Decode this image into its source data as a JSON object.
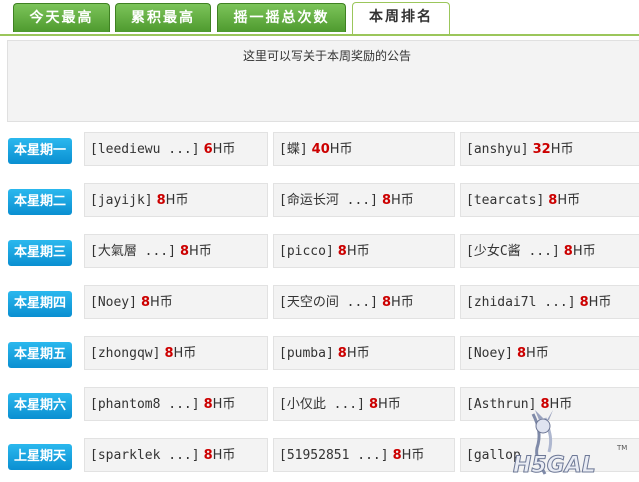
{
  "tabs": [
    {
      "label": "今天最高",
      "active": false
    },
    {
      "label": "累积最高",
      "active": false
    },
    {
      "label": "摇一摇总次数",
      "active": false
    },
    {
      "label": "本周排名",
      "active": true
    }
  ],
  "notice": "这里可以写关于本周奖励的公告",
  "rows": [
    {
      "day": "本星期一",
      "entries": [
        {
          "name": "[leediewu ...]",
          "amount": "6",
          "unit": "H币"
        },
        {
          "name": "[蝶]",
          "amount": "40",
          "unit": "H币"
        },
        {
          "name": "[anshyu]",
          "amount": "32",
          "unit": "H币"
        }
      ]
    },
    {
      "day": "本星期二",
      "entries": [
        {
          "name": "[jayijk]",
          "amount": "8",
          "unit": "H币"
        },
        {
          "name": "[命运长河 ...]",
          "amount": "8",
          "unit": "H币"
        },
        {
          "name": "[tearcats]",
          "amount": "8",
          "unit": "H币"
        }
      ]
    },
    {
      "day": "本星期三",
      "entries": [
        {
          "name": "[大氣層 ...]",
          "amount": "8",
          "unit": "H币"
        },
        {
          "name": "[picco]",
          "amount": "8",
          "unit": "H币"
        },
        {
          "name": "[少女C酱 ...]",
          "amount": "8",
          "unit": "H币"
        }
      ]
    },
    {
      "day": "本星期四",
      "entries": [
        {
          "name": "[Noey]",
          "amount": "8",
          "unit": "H币"
        },
        {
          "name": "[天空の间 ...]",
          "amount": "8",
          "unit": "H币"
        },
        {
          "name": "[zhidai7l ...]",
          "amount": "8",
          "unit": "H币"
        }
      ]
    },
    {
      "day": "本星期五",
      "entries": [
        {
          "name": "[zhongqw]",
          "amount": "8",
          "unit": "H币"
        },
        {
          "name": "[pumba]",
          "amount": "8",
          "unit": "H币"
        },
        {
          "name": "[Noey]",
          "amount": "8",
          "unit": "H币"
        }
      ]
    },
    {
      "day": "本星期六",
      "entries": [
        {
          "name": "[phantom8 ...]",
          "amount": "8",
          "unit": "H币"
        },
        {
          "name": "[小仅此 ...]",
          "amount": "8",
          "unit": "H币"
        },
        {
          "name": "[Asthrun]",
          "amount": "8",
          "unit": "H币"
        }
      ]
    },
    {
      "day": "上星期天",
      "entries": [
        {
          "name": "[sparklek ...]",
          "amount": "8",
          "unit": "H币"
        },
        {
          "name": "[51952851 ...]",
          "amount": "8",
          "unit": "H币"
        },
        {
          "name": "[gallop",
          "amount": "",
          "unit": ""
        }
      ]
    }
  ],
  "logo": {
    "text": "H5GAL",
    "mark": "TM"
  },
  "colors": {
    "tab_green": "#4e9a2e",
    "day_blue": "#0a8fd1",
    "amount_red": "#cc0000",
    "panel": "#f3f3f3"
  }
}
